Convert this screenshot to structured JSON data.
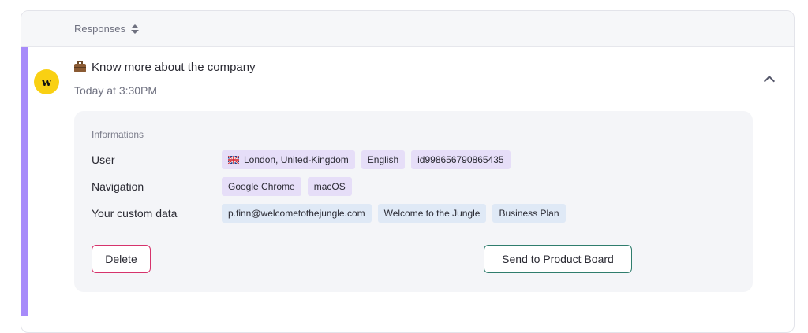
{
  "header": {
    "label": "Responses",
    "sort_icon": "sort-icon"
  },
  "response": {
    "accent_color": "#a78bfa",
    "avatar": {
      "letter": "w",
      "bg_color": "#f9d013"
    },
    "title_icon": "briefcase-icon",
    "title": "Know more about the company",
    "timestamp": "Today at 3:30PM",
    "toggle_icon": "chevron-up-icon"
  },
  "informations": {
    "title": "Informations",
    "rows": [
      {
        "label": "User",
        "tags": [
          "London, United-Kingdom",
          "English",
          "id998656790865435"
        ]
      },
      {
        "label": "Navigation",
        "tags": [
          "Google Chrome",
          "macOS"
        ]
      },
      {
        "label": "Your custom data",
        "tags": [
          "p.finn@welcometothejungle.com",
          "Welcome to the Jungle",
          "Business Plan"
        ]
      }
    ]
  },
  "actions": {
    "delete_label": "Delete",
    "send_label": "Send to Product Board"
  },
  "colors": {
    "delete_border": "#d6336c",
    "send_border": "#2f7d6d",
    "tag_purple": "#e6def8",
    "tag_blue": "#dfe9f6"
  }
}
